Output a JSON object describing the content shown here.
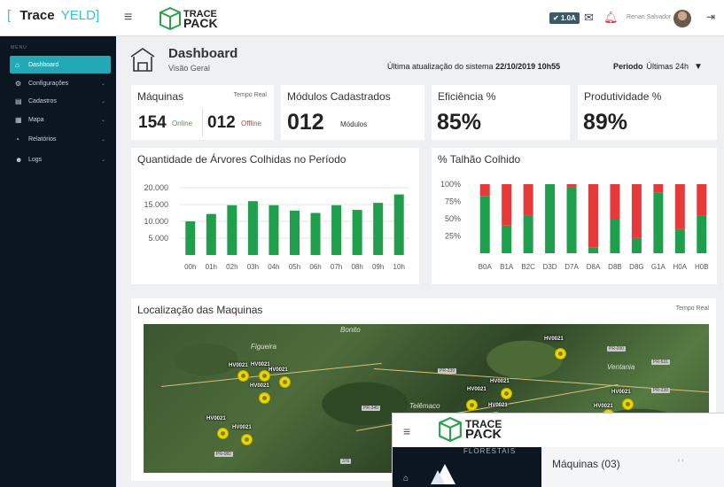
{
  "header": {
    "brand_open": "[",
    "brand_a": "Trace",
    "brand_b": "YELD",
    "brand_close": "]",
    "menu_icon": "hamburger-icon",
    "logo_line1": "TRACE",
    "logo_line2": "PACK",
    "version": "✔ 1.0A",
    "user_name": "Renan Salvador",
    "icons": [
      "check-icon",
      "mail-icon",
      "bell-icon",
      "logout-icon"
    ]
  },
  "sidebar": {
    "heading": "MENU",
    "items": [
      {
        "label": "Dashboard",
        "icon": "home-icon",
        "glyph": "⌂"
      },
      {
        "label": "Configurações",
        "icon": "gear-icon",
        "glyph": "⚙"
      },
      {
        "label": "Cadastros",
        "icon": "file-icon",
        "glyph": "▤"
      },
      {
        "label": "Mapa",
        "icon": "map-icon",
        "glyph": "▦"
      },
      {
        "label": "Relatórios",
        "icon": "pie-chart-icon",
        "glyph": "◔"
      },
      {
        "label": "Logs",
        "icon": "users-icon",
        "glyph": "☻"
      }
    ]
  },
  "page": {
    "title": "Dashboard",
    "subtitle": "Visão Geral",
    "update_label": "Última atualização do sistema",
    "update_value": "22/10/2019 10h55",
    "period_label": "Periodo",
    "period_value": "Últimas 24h"
  },
  "cards": {
    "maquinas": {
      "title": "Máquinas",
      "tag": "Tempo Real",
      "online_count": "154",
      "online_label": "Online",
      "offline_count": "012",
      "offline_label": "Offline"
    },
    "modulos": {
      "title": "Módulos Cadastrados",
      "count": "012",
      "unit": "Módulos"
    },
    "eficiencia": {
      "title": "Eficiência %",
      "value": "85%"
    },
    "produtividade": {
      "title": "Produtividade %",
      "value": "89%"
    }
  },
  "map": {
    "title": "Localização das Maquinas",
    "tag": "Tempo Real",
    "towns": [
      "Bonito",
      "Ventania",
      "Telêmaco",
      "Figueira"
    ],
    "roads": [
      "PR-239",
      "PR-090",
      "PR-531",
      "PR-239",
      "PR-340",
      "PR-082",
      "376"
    ],
    "machine_label": "HV0021"
  },
  "overlay": {
    "logo_line1": "TRACE",
    "logo_line2": "PACK",
    "module_title": "MÓDULOS",
    "module_sub": "FLORESTAIS",
    "maquinas": "Máquinas (03)"
  },
  "chart_data": [
    {
      "type": "bar",
      "title": "Quantidade de Árvores Colhidas no Período",
      "categories": [
        "00h",
        "01h",
        "02h",
        "03h",
        "04h",
        "05h",
        "06h",
        "07h",
        "08h",
        "09h",
        "10h"
      ],
      "values": [
        10000,
        12200,
        14800,
        16000,
        14800,
        13200,
        12500,
        14800,
        13400,
        15500,
        18000
      ],
      "yticks": [
        "20.000",
        "15.000",
        "10.000",
        "5.000"
      ],
      "ylim": [
        0,
        20000
      ],
      "color": "#1f9e4c"
    },
    {
      "type": "bar",
      "stacked": true,
      "title": "% Talhão Colhido",
      "categories": [
        "B0A",
        "B1A",
        "B2C",
        "D3D",
        "D7A",
        "D8A",
        "D8B",
        "D8G",
        "G1A",
        "H0A",
        "H0B"
      ],
      "series": [
        {
          "values": [
            83,
            40,
            55,
            100,
            95,
            8,
            50,
            22,
            88,
            35,
            55
          ],
          "color": "#1f9e4c"
        },
        {
          "values": [
            17,
            60,
            45,
            0,
            5,
            92,
            50,
            78,
            12,
            65,
            45
          ],
          "color": "#e63a3a"
        }
      ],
      "yticks": [
        "100%",
        "75%",
        "50%",
        "25%"
      ],
      "ylim": [
        0,
        100
      ]
    }
  ]
}
